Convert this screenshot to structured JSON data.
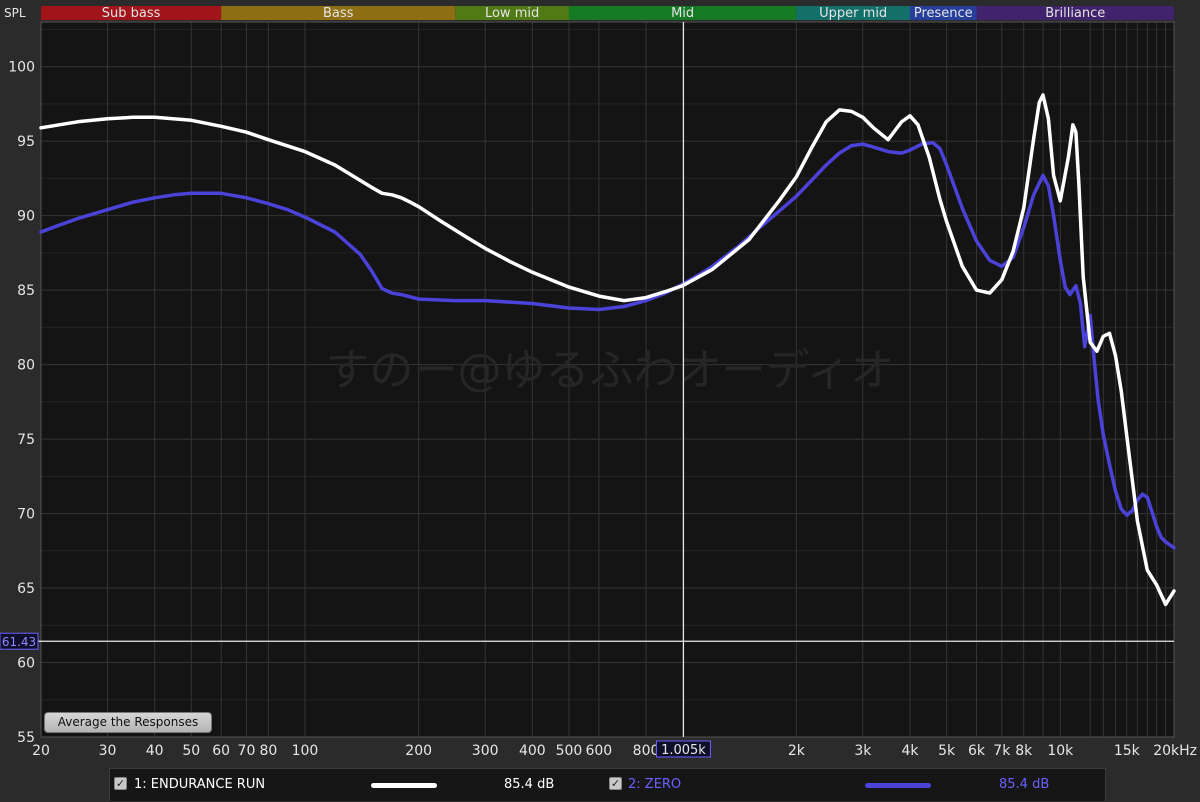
{
  "chart_data": {
    "type": "line",
    "ylabel": "SPL",
    "xlabel": "",
    "x_scale": "log",
    "xlim": [
      20,
      20000
    ],
    "ylim": [
      55,
      103
    ],
    "y_ticks": [
      55,
      60,
      65,
      70,
      75,
      80,
      85,
      90,
      95,
      100
    ],
    "x_ticks": [
      {
        "value": 20,
        "label": "20"
      },
      {
        "value": 30,
        "label": "30"
      },
      {
        "value": 40,
        "label": "40"
      },
      {
        "value": 50,
        "label": "50"
      },
      {
        "value": 60,
        "label": "60"
      },
      {
        "value": 70,
        "label": "70"
      },
      {
        "value": 80,
        "label": "80"
      },
      {
        "value": 100,
        "label": "100"
      },
      {
        "value": 200,
        "label": "200"
      },
      {
        "value": 300,
        "label": "300"
      },
      {
        "value": 400,
        "label": "400"
      },
      {
        "value": 500,
        "label": "500"
      },
      {
        "value": 600,
        "label": "600"
      },
      {
        "value": 800,
        "label": "800"
      },
      {
        "value": 2000,
        "label": "2k"
      },
      {
        "value": 3000,
        "label": "3k"
      },
      {
        "value": 4000,
        "label": "4k"
      },
      {
        "value": 5000,
        "label": "5k"
      },
      {
        "value": 6000,
        "label": "6k"
      },
      {
        "value": 7000,
        "label": "7k"
      },
      {
        "value": 8000,
        "label": "8k"
      },
      {
        "value": 10000,
        "label": "10k"
      },
      {
        "value": 15000,
        "label": "15k"
      },
      {
        "value": 20000,
        "label": "20kHz"
      }
    ],
    "grid": true,
    "bands": [
      {
        "label": "Sub bass",
        "from": 20,
        "to": 60,
        "color": "#a0141a"
      },
      {
        "label": "Bass",
        "from": 60,
        "to": 250,
        "color": "#8d6e12"
      },
      {
        "label": "Low mid",
        "from": 250,
        "to": 500,
        "color": "#4f7a14"
      },
      {
        "label": "Mid",
        "from": 500,
        "to": 2000,
        "color": "#157a23"
      },
      {
        "label": "Upper mid",
        "from": 2000,
        "to": 4000,
        "color": "#136f6a"
      },
      {
        "label": "Presence",
        "from": 4000,
        "to": 6000,
        "color": "#273f9a"
      },
      {
        "label": "Brilliance",
        "from": 6000,
        "to": 20000,
        "color": "#40236c"
      }
    ],
    "cursor": {
      "x": 1005,
      "x_label": "1.005k",
      "y": 61.43,
      "y_label": "61.43"
    },
    "watermark": "すのー@ゆるふわオーディオ",
    "series": [
      {
        "name": "1: ENDURANCE RUN",
        "color": "#ffffff",
        "x": [
          20,
          25,
          30,
          35,
          40,
          50,
          60,
          70,
          80,
          100,
          120,
          150,
          160,
          170,
          180,
          190,
          200,
          230,
          270,
          300,
          350,
          400,
          500,
          600,
          700,
          800,
          900,
          1000,
          1200,
          1500,
          1800,
          2000,
          2200,
          2400,
          2600,
          2800,
          3000,
          3200,
          3500,
          3800,
          4000,
          4200,
          4500,
          4800,
          5000,
          5500,
          6000,
          6500,
          7000,
          7500,
          8000,
          8500,
          8800,
          9000,
          9300,
          9600,
          10000,
          10500,
          10800,
          11000,
          11200,
          11500,
          12000,
          12500,
          13000,
          13500,
          14000,
          14500,
          15000,
          16000,
          17000,
          18000,
          19000,
          20000
        ],
        "values": [
          95.9,
          96.3,
          96.5,
          96.6,
          96.6,
          96.4,
          96.0,
          95.6,
          95.1,
          94.3,
          93.4,
          91.9,
          91.5,
          91.4,
          91.2,
          90.9,
          90.6,
          89.6,
          88.5,
          87.8,
          86.9,
          86.2,
          85.2,
          84.6,
          84.3,
          84.5,
          84.9,
          85.3,
          86.4,
          88.4,
          91.0,
          92.6,
          94.6,
          96.3,
          97.1,
          97.0,
          96.6,
          95.9,
          95.1,
          96.3,
          96.7,
          96.1,
          93.9,
          91.1,
          89.6,
          86.6,
          85.0,
          84.8,
          85.7,
          87.6,
          90.5,
          95.2,
          97.6,
          98.1,
          96.5,
          92.7,
          91.0,
          93.9,
          96.1,
          95.6,
          92.1,
          85.9,
          81.5,
          80.9,
          81.9,
          82.1,
          80.6,
          78.2,
          75.2,
          69.5,
          66.2,
          65.2,
          63.9,
          64.8
        ]
      },
      {
        "name": "2: ZERO",
        "color": "#4b43d9",
        "x": [
          20,
          22,
          25,
          30,
          35,
          40,
          45,
          50,
          55,
          60,
          70,
          80,
          90,
          100,
          120,
          140,
          150,
          160,
          170,
          180,
          200,
          250,
          300,
          400,
          500,
          600,
          700,
          800,
          900,
          1000,
          1100,
          1200,
          1400,
          1600,
          1800,
          2000,
          2200,
          2400,
          2600,
          2800,
          3000,
          3200,
          3500,
          3800,
          4000,
          4300,
          4600,
          4800,
          5000,
          5500,
          6000,
          6500,
          7000,
          7500,
          8000,
          8500,
          9000,
          9300,
          9600,
          10000,
          10300,
          10600,
          11000,
          11300,
          11600,
          12000,
          12300,
          12600,
          13000,
          13500,
          14000,
          14500,
          15000,
          15500,
          16000,
          16500,
          17000,
          17500,
          18000,
          18500,
          19000,
          19500,
          20000
        ],
        "values": [
          88.9,
          89.3,
          89.8,
          90.4,
          90.9,
          91.2,
          91.4,
          91.5,
          91.5,
          91.5,
          91.2,
          90.8,
          90.4,
          89.9,
          88.9,
          87.4,
          86.3,
          85.1,
          84.8,
          84.7,
          84.4,
          84.3,
          84.3,
          84.1,
          83.8,
          83.7,
          83.9,
          84.3,
          84.8,
          85.4,
          86.0,
          86.6,
          87.9,
          89.2,
          90.3,
          91.3,
          92.4,
          93.4,
          94.2,
          94.7,
          94.8,
          94.6,
          94.3,
          94.2,
          94.4,
          94.8,
          94.9,
          94.5,
          93.4,
          90.5,
          88.3,
          87.0,
          86.6,
          87.2,
          89.2,
          91.4,
          92.7,
          92.0,
          90.0,
          87.0,
          85.2,
          84.7,
          85.3,
          84.1,
          81.2,
          83.3,
          80.2,
          77.6,
          75.3,
          73.3,
          71.5,
          70.3,
          69.9,
          70.2,
          70.9,
          71.3,
          71.1,
          70.1,
          69.1,
          68.4,
          68.1,
          67.9,
          67.7
        ]
      }
    ]
  },
  "controls": {
    "average_button": "Average the Responses"
  },
  "legend": [
    {
      "label": "1: ENDURANCE RUN",
      "db": "85.4 dB",
      "checked": true,
      "text_color": "#ffffff",
      "line_color": "#ffffff"
    },
    {
      "label": "2: ZERO",
      "db": "85.4 dB",
      "checked": true,
      "text_color": "#6a61ff",
      "line_color": "#4b43d9"
    }
  ]
}
